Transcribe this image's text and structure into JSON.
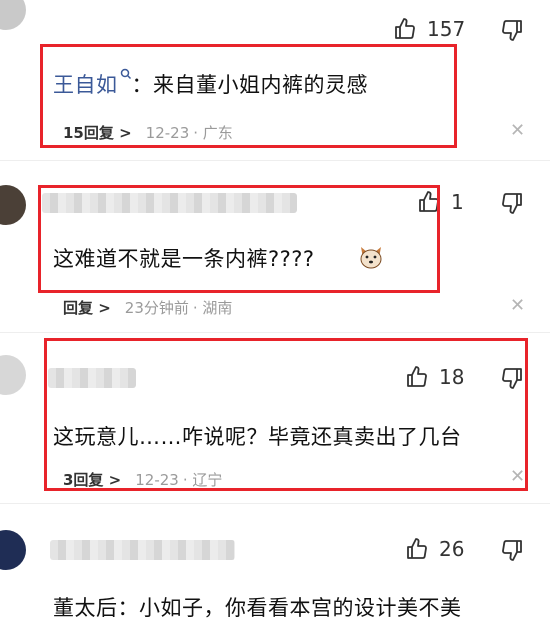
{
  "comments": [
    {
      "username": "王自如",
      "badge_icon": "search-badge-icon",
      "separator": "：",
      "text": "来自董小姐内裤的灵感",
      "reply_label": "15回复 >",
      "date": "12-23",
      "location": "· 广东",
      "likes": "157"
    },
    {
      "text": "这难道不就是一条内裤????",
      "emoji_icon": "dog-face-icon",
      "reply_label": "回复 >",
      "date": "23分钟前",
      "location": "· 湖南",
      "likes": "1"
    },
    {
      "text": "这玩意儿……咋说呢？毕竟还真卖出了几台",
      "reply_label": "3回复 >",
      "date": "12-23",
      "location": "· 辽宁",
      "likes": "18"
    },
    {
      "text": "董太后：小如子，你看看本宫的设计美不美",
      "likes": "26"
    }
  ],
  "colors": {
    "highlight_border": "#e8232a",
    "username": "#3b5998",
    "meta_text": "#9a9a9a"
  }
}
